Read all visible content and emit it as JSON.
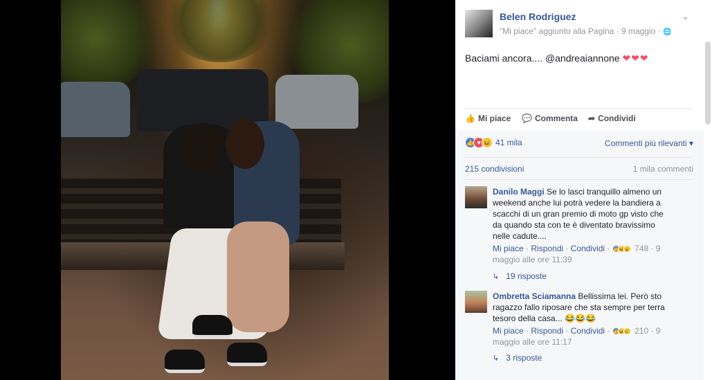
{
  "post": {
    "author": "Belen Rodriguez",
    "meta": "\"Mi piace\" aggiunto alla Pagina · 9 maggio · ",
    "text": "Baciami ancora.... @andreaiannone ",
    "hearts": "❤❤❤"
  },
  "actions": {
    "like": "Mi piace",
    "comment": "Commenta",
    "share": "Condividi"
  },
  "reactions": {
    "count": "41 mila",
    "sort": "Commenti più rilevanti"
  },
  "stats": {
    "shares": "215 condivisioni",
    "comments": "1 mila commenti"
  },
  "comments": [
    {
      "name": "Danilo Maggi",
      "text": " Se lo lasci tranquillo almeno un weekend anche lui potrà vedere la bandiera a scacchi di un gran premio di moto gp visto che da quando sta con te è diventato bravissimo nelle cadute....",
      "like": "Mi piace",
      "reply": "Rispondi",
      "share": "Condividi",
      "count": "748",
      "time": " · 9 maggio alle ore 11:39",
      "replies": "19 risposte"
    },
    {
      "name": "Ombretta Sciamanna",
      "text": " Bellissima lei. Però sto ragazzo fallo riposare che sta sempre per terra tesoro della casa... 😂😂😂",
      "like": "Mi piace",
      "reply": "Rispondi",
      "share": "Condividi",
      "count": "210",
      "time": " · 9 maggio alle ore 11:17",
      "replies": "3 risposte"
    }
  ],
  "icons": {
    "thumb": "👍",
    "comment": "💬",
    "share": "➦",
    "chevron": "⌄",
    "globe": "🌐",
    "sort": "▾",
    "reply": "↳"
  }
}
